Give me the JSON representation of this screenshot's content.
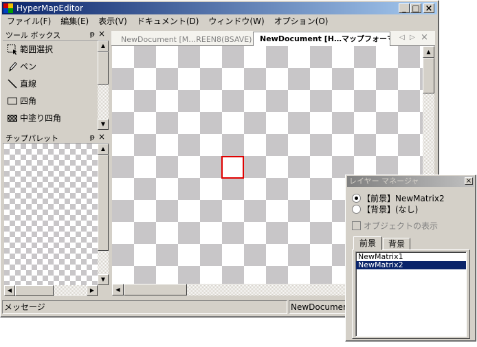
{
  "app": {
    "title": "HyperMapEditor"
  },
  "window_buttons": {
    "minimize": "_",
    "maximize": "□",
    "close": "×"
  },
  "menu": [
    "ファイル(F)",
    "編集(E)",
    "表示(V)",
    "ドキュメント(D)",
    "ウィンドウ(W)",
    "オプション(O)"
  ],
  "toolbox": {
    "title": "ツール ボックス",
    "pin": "ᵽ",
    "close": "×",
    "tools": [
      {
        "label": "範囲選択",
        "icon": "select-icon"
      },
      {
        "label": "ペン",
        "icon": "pen-icon"
      },
      {
        "label": "直線",
        "icon": "line-icon"
      },
      {
        "label": "四角",
        "icon": "rectangle-icon"
      },
      {
        "label": "中塗り四角",
        "icon": "filled-rectangle-icon"
      }
    ]
  },
  "chip_palette": {
    "title": "チップパレット",
    "pin": "ᵽ",
    "close": "×"
  },
  "tabs": [
    {
      "label": "NewDocument [M…REEN8(BSAVE)]",
      "active": false
    },
    {
      "label": "NewDocument [H…マップフォーマット]",
      "active": true
    }
  ],
  "tab_controls": {
    "prev": "◁",
    "next": "▷",
    "close": "×"
  },
  "status": {
    "message": "メッセージ",
    "document": "NewDocument"
  },
  "layer_manager": {
    "title": "レイヤー マネージャ",
    "close": "×",
    "radio_foreground": "【前景】NewMatrix2",
    "radio_background": "【背景】(なし)",
    "foreground_selected": true,
    "show_objects": "オブジェクトの表示",
    "tabs": [
      "前景",
      "背景"
    ],
    "list": [
      "NewMatrix1",
      "NewMatrix2"
    ],
    "selected_index": 1
  },
  "colors": {
    "titlebar_start": "#0a246a",
    "titlebar_end": "#a6caf0",
    "selection": "#0a246a",
    "cursor_red": "#e00000"
  }
}
